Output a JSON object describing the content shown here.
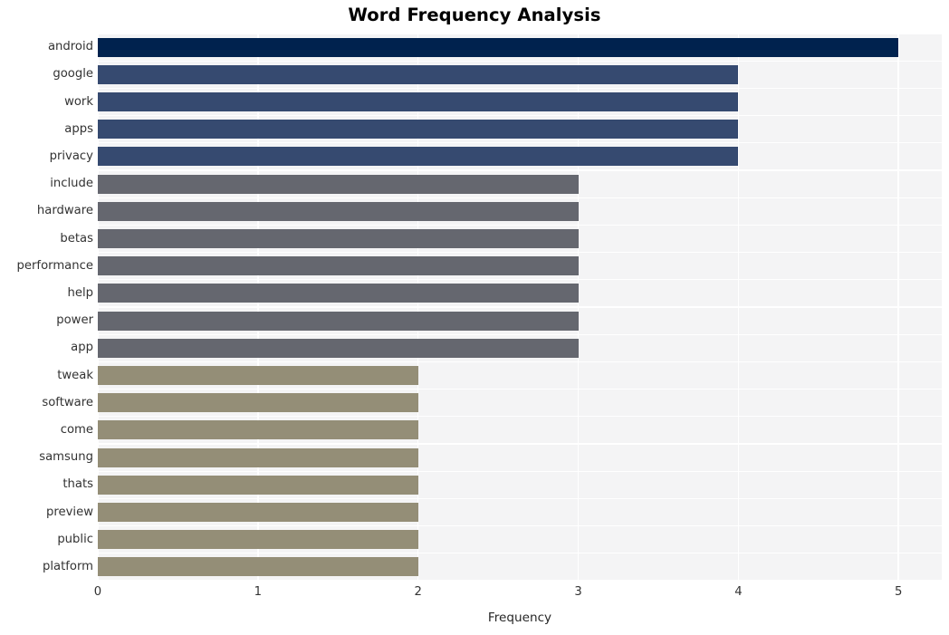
{
  "chart_data": {
    "type": "bar",
    "orientation": "horizontal",
    "title": "Word Frequency Analysis",
    "xlabel": "Frequency",
    "ylabel": "",
    "xlim": [
      0,
      5.27
    ],
    "xticks": [
      0,
      1,
      2,
      3,
      4,
      5
    ],
    "xtick_labels": [
      "0",
      "1",
      "2",
      "3",
      "4",
      "5"
    ],
    "grid": true,
    "legend": null,
    "categories": [
      "android",
      "google",
      "work",
      "apps",
      "privacy",
      "include",
      "hardware",
      "betas",
      "performance",
      "help",
      "power",
      "app",
      "tweak",
      "software",
      "come",
      "samsung",
      "thats",
      "preview",
      "public",
      "platform"
    ],
    "values": [
      5,
      4,
      4,
      4,
      4,
      3,
      3,
      3,
      3,
      3,
      3,
      3,
      2,
      2,
      2,
      2,
      2,
      2,
      2,
      2
    ],
    "bar_colors": [
      "#00224e",
      "#364a70",
      "#364a70",
      "#364a70",
      "#364a70",
      "#65676f",
      "#65676f",
      "#65676f",
      "#65676f",
      "#65676f",
      "#65676f",
      "#65676f",
      "#948e77",
      "#948e77",
      "#948e77",
      "#948e77",
      "#948e77",
      "#948e77",
      "#948e77",
      "#948e77"
    ]
  },
  "style": {
    "figure_background": "#ffffff",
    "plot_background": "#f4f4f5",
    "grid_color": "#ffffff",
    "tick_label_color": "#333333",
    "title_color": "#000000"
  }
}
